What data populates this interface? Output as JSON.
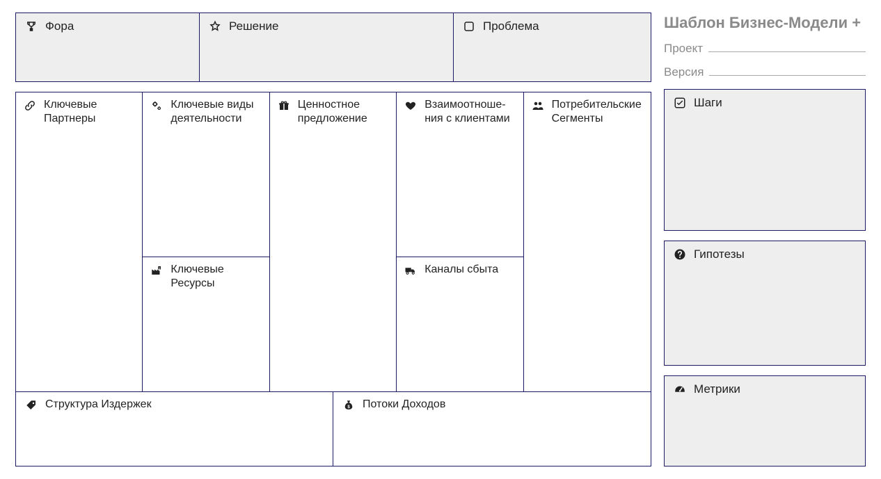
{
  "doc_title": "Шаблон Бизнес-Модели +",
  "fields": {
    "project_label": "Проект",
    "version_label": "Версия"
  },
  "top": {
    "fora": {
      "label": "Фора",
      "icon": "trophy-icon"
    },
    "solution": {
      "label": "Решение",
      "icon": "star-icon"
    },
    "problem": {
      "label": "Проблема",
      "icon": "square-icon"
    }
  },
  "canvas": {
    "partners": {
      "label": "Ключевые Партнеры",
      "icon": "link-icon"
    },
    "activities": {
      "label": "Ключевые виды деятельности",
      "icon": "gears-icon"
    },
    "resources": {
      "label": "Ключевые Ресурсы",
      "icon": "factory-icon"
    },
    "value": {
      "label": "Ценностное предложение",
      "icon": "gift-icon"
    },
    "relationships": {
      "label": "Взаимоотноше­ния с клиентами",
      "icon": "heart-icon"
    },
    "channels": {
      "label": "Каналы сбыта",
      "icon": "truck-icon"
    },
    "segments": {
      "label": "Потребитель­ские Сегменты",
      "icon": "users-icon"
    },
    "costs": {
      "label": "Структура Издержек",
      "icon": "tag-icon"
    },
    "revenue": {
      "label": "Потоки Доходов",
      "icon": "moneybag-icon"
    }
  },
  "side": {
    "steps": {
      "label": "Шаги",
      "icon": "check-icon"
    },
    "hypotheses": {
      "label": "Гипотезы",
      "icon": "question-icon"
    },
    "metrics": {
      "label": "Метрики",
      "icon": "gauge-icon"
    }
  }
}
